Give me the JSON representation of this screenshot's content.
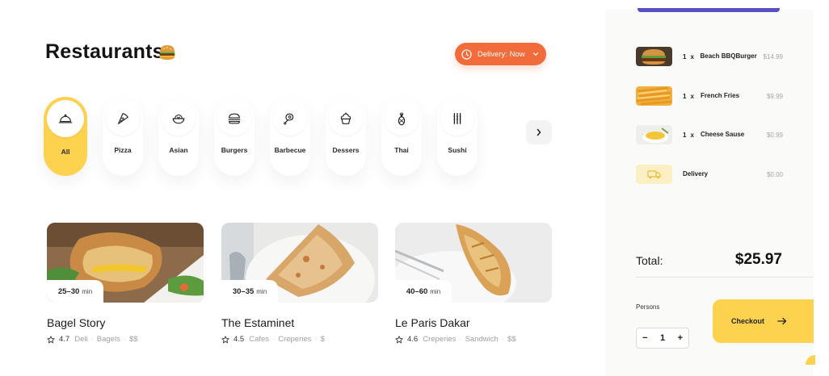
{
  "header": {
    "title": "Restaurants",
    "delivery_label": "Delivery: Now"
  },
  "categories": [
    {
      "label": "All",
      "icon": "cloche-icon",
      "active": true
    },
    {
      "label": "Pizza",
      "icon": "pizza-icon"
    },
    {
      "label": "Asian",
      "icon": "bowl-icon"
    },
    {
      "label": "Burgers",
      "icon": "burger-icon"
    },
    {
      "label": "Barbecue",
      "icon": "meat-icon"
    },
    {
      "label": "Dessers",
      "icon": "cupcake-icon"
    },
    {
      "label": "Thai",
      "icon": "pineapple-icon"
    },
    {
      "label": "Sushi",
      "icon": "chopsticks-icon"
    }
  ],
  "restaurants": [
    {
      "time": "25–30",
      "unit": "min",
      "name": "Bagel Story",
      "rating": "4.7",
      "tags": [
        "Deli",
        "Bagels",
        "$$"
      ]
    },
    {
      "time": "30–35",
      "unit": "min",
      "name": "The Estaminet",
      "rating": "4.5",
      "tags": [
        "Cafes",
        "Creperies",
        "$"
      ]
    },
    {
      "time": "40–60",
      "unit": "min",
      "name": "Le Paris Dakar",
      "rating": "4.6",
      "tags": [
        "Creperies",
        "Sandwich",
        "$$"
      ]
    }
  ],
  "order": {
    "items": [
      {
        "qty": "1",
        "x": "x",
        "name": "Beach BBQBurger",
        "price": "$14.99"
      },
      {
        "qty": "1",
        "x": "x",
        "name": "French Fries",
        "price": "$9.99"
      },
      {
        "qty": "1",
        "x": "x",
        "name": "Cheese Sause",
        "price": "$0.99"
      }
    ],
    "delivery": {
      "name": "Delivery",
      "price": "$0.00"
    },
    "total_label": "Total:",
    "total_value": "$25.97",
    "persons_label": "Persons",
    "persons": {
      "minus": "−",
      "count": "1",
      "plus": "+"
    },
    "checkout_label": "Checkout"
  },
  "colors": {
    "accent_yellow": "#fdd24f",
    "accent_orange": "#f26b3a",
    "panel_accent": "#5b4fc4"
  }
}
